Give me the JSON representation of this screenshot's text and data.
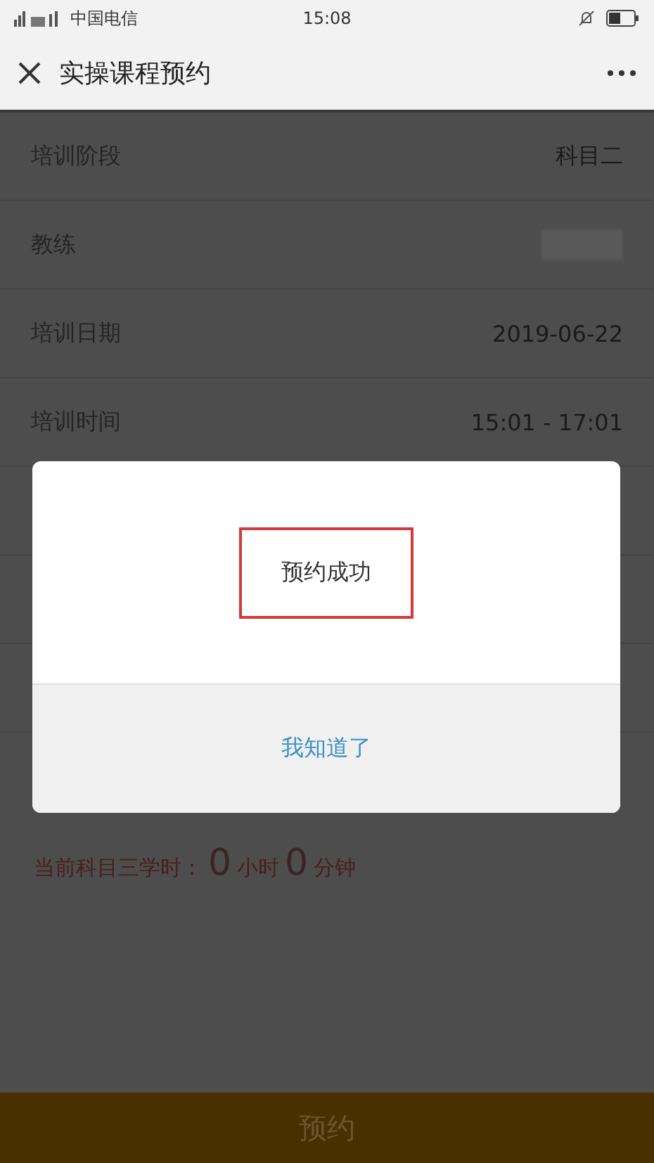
{
  "status_bar": {
    "carrier": "中国电信",
    "time": "15:08"
  },
  "header": {
    "title": "实操课程预约"
  },
  "form_rows": [
    {
      "label": "培训阶段",
      "value": "科目二",
      "kind": "text"
    },
    {
      "label": "教练",
      "kind": "blurred"
    },
    {
      "label": "培训日期",
      "value": "2019-06-22",
      "kind": "text"
    },
    {
      "label": "培训时间",
      "value": "15:01 - 17:01",
      "kind": "text"
    },
    {
      "kind": "hidden"
    },
    {
      "kind": "hidden"
    },
    {
      "kind": "hidden"
    }
  ],
  "hours_note": {
    "label": "当前科目三学时：",
    "hours": "0",
    "hours_unit": "小时",
    "minutes": "0",
    "minutes_unit": "分钟"
  },
  "bottom_button": {
    "label": "预约",
    "disabled": true
  },
  "dialog": {
    "message": "预约成功",
    "highlighted": true,
    "button": "我知道了"
  }
}
